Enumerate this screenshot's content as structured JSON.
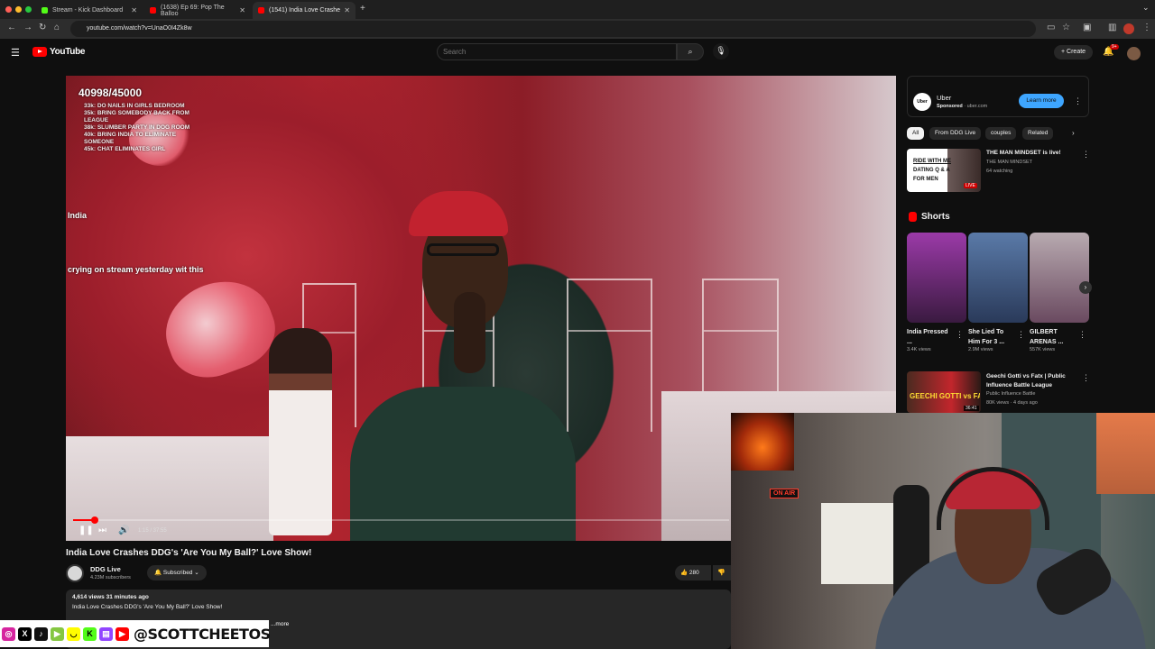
{
  "browser": {
    "tabs": [
      {
        "title": "Stream - Kick Dashboard",
        "color": "#53fc18",
        "active": false
      },
      {
        "title": "(1638) Ep 69: Pop The Balloo",
        "color": "#ff0000",
        "active": false
      },
      {
        "title": "(1541) India Love Crashe",
        "color": "#ff0000",
        "active": true
      }
    ],
    "new_tab": "+",
    "url": "youtube.com/watch?v=UnaO0I4Zk8w"
  },
  "header": {
    "logo_text": "YouTube",
    "search_placeholder": "Search",
    "create_label": "Create",
    "notification_count": "9+"
  },
  "video": {
    "overlay_goal": "40998/45000",
    "overlay_goals": [
      "33k: DO NAILS IN GIRLS BEDROOM",
      "35k: BRING SOMEBODY BACK FROM LEAGUE",
      "38k: SLUMBER PARTY IN DOG ROOM",
      "40k: BRING INDIA TO ELIMINATE SOMEONE",
      "45k: CHAT ELIMINATES GIRL"
    ],
    "overlay_india": "India",
    "overlay_crying": "crying on stream yesterday wit this",
    "time": "1:15 / 37:55",
    "progress": 0.033,
    "title": "India Love Crashes DDG's 'Are You My Ball?' Love Show!",
    "channel": "DDG Live",
    "subscribers": "4.23M subscribers",
    "subscribe_label": "Subscribed",
    "likes": "280",
    "views_line": "4,614 views  31 minutes ago",
    "description": "India Love Crashes DDG's 'Are You My Ball?' Love Show!",
    "more_label": "...more"
  },
  "streamer": {
    "handle": "@SCOTTCHEETOS",
    "onair": "ON AIR"
  },
  "sidebar": {
    "ad": {
      "logo": "Uber",
      "name": "Uber",
      "sponsored": "Sponsored",
      "domain": "· uber.com",
      "cta": "Learn more"
    },
    "chips": [
      "All",
      "From DDG Live",
      "couples",
      "Related"
    ],
    "live_item": {
      "thumb_text": [
        "RIDE WITH ME",
        "DATING Q & A",
        "FOR MEN"
      ],
      "badge": "LIVE",
      "title": "THE MAN MINDSET  is live!",
      "channel": "THE MAN MINDSET",
      "watching": "64 watching"
    },
    "shorts_title": "Shorts",
    "shorts": [
      {
        "title": "India Pressed ...",
        "views": "3.4K views",
        "color": "#6a2a7a"
      },
      {
        "title": "She Lied To Him For 3 ...",
        "views": "2.9M views",
        "color": "#3a5a8a"
      },
      {
        "title": "GILBERT ARENAS ...",
        "views": "557K views",
        "color": "#8a7a80"
      }
    ],
    "rec_item": {
      "thumb_text": "GEECHI GOTTI vs FATX",
      "duration": "36:41",
      "title": "Geechi Gotti vs Fatx | Public Influence Battle League",
      "channel": "Public Influence Battle",
      "meta": "80K views · 4 days ago"
    }
  }
}
